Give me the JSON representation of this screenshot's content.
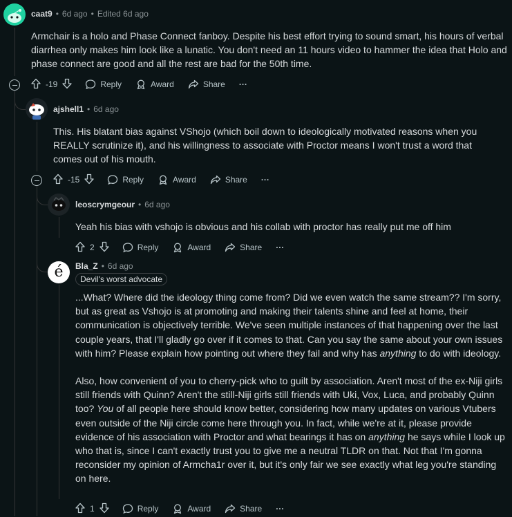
{
  "comments": [
    {
      "username": "caat9",
      "age": "6d ago",
      "edited": "Edited 6d ago",
      "body": [
        "Armchair is a holo and Phase Connect fanboy. Despite his best effort trying to sound smart, his hours of verbal diarrhea only makes him look like a lunatic. You don't need an 11 hours video to hammer the idea that Holo and phase connect are good and all the rest are bad for the 50th time."
      ],
      "score": "-19",
      "reply": "Reply",
      "award": "Award",
      "share": "Share",
      "more": "···"
    },
    {
      "username": "ajshell1",
      "age": "6d ago",
      "body": [
        "This. His blatant bias against VShojo (which boil down to ideologically motivated reasons when you REALLY scrutinize it), and his willingness to associate with Proctor means I won't trust a word that comes out of his mouth."
      ],
      "score": "-15",
      "reply": "Reply",
      "award": "Award",
      "share": "Share",
      "more": "···"
    },
    {
      "username": "leoscrymgeour",
      "age": "6d ago",
      "body": [
        "Yeah his bias with vshojo is obvious and his collab with proctor has really put me off him"
      ],
      "score": "2",
      "reply": "Reply",
      "award": "Award",
      "share": "Share",
      "more": "···"
    },
    {
      "username": "Bla_Z",
      "age": "6d ago",
      "flair": "Devil's worst advocate",
      "avatar_letter": "é",
      "body_p1": {
        "a": "...What? Where did the ideology thing come from? Did we even watch the same stream?? I'm sorry, but as great as Vshojo is at promoting and making their talents shine and feel at home, their communication is objectively terrible. We've seen multiple instances of that happening over the last couple years, that I'll gladly go over if it comes to that. Can you say the same about your own issues with him? Please explain how pointing out where they fail and why has ",
        "em": "anything",
        "b": " to do with ideology."
      },
      "body_p2": {
        "a": "Also, how convenient of you to cherry-pick who to guilt by association. Aren't most of the ex-Niji girls still friends with Quinn? Aren't the still-Niji girls still friends with Uki, Vox, Luca, and probably Quinn too? ",
        "em1": "You",
        "b": " of all people here should know better, considering how many updates on various Vtubers even outside of the Niji circle come here through you. In fact, while we're at it, please provide evidence of his association with Proctor and what bearings it has on ",
        "em2": "anything",
        "c": " he says while I look up who that is, since I can't exactly trust you to give me a neutral TLDR on that. Not that I'm gonna reconsider my opinion of Armcha1r over it, but it's only fair we see exactly what leg you're standing on here."
      },
      "score": "1",
      "reply": "Reply",
      "award": "Award",
      "share": "Share",
      "more": "···"
    }
  ],
  "separator": "•",
  "colors": {
    "background": "#0b1416",
    "text": "#d7dadc",
    "muted": "#8b9396",
    "thread": "#343536",
    "avatar_green": "#1fd1a0"
  }
}
